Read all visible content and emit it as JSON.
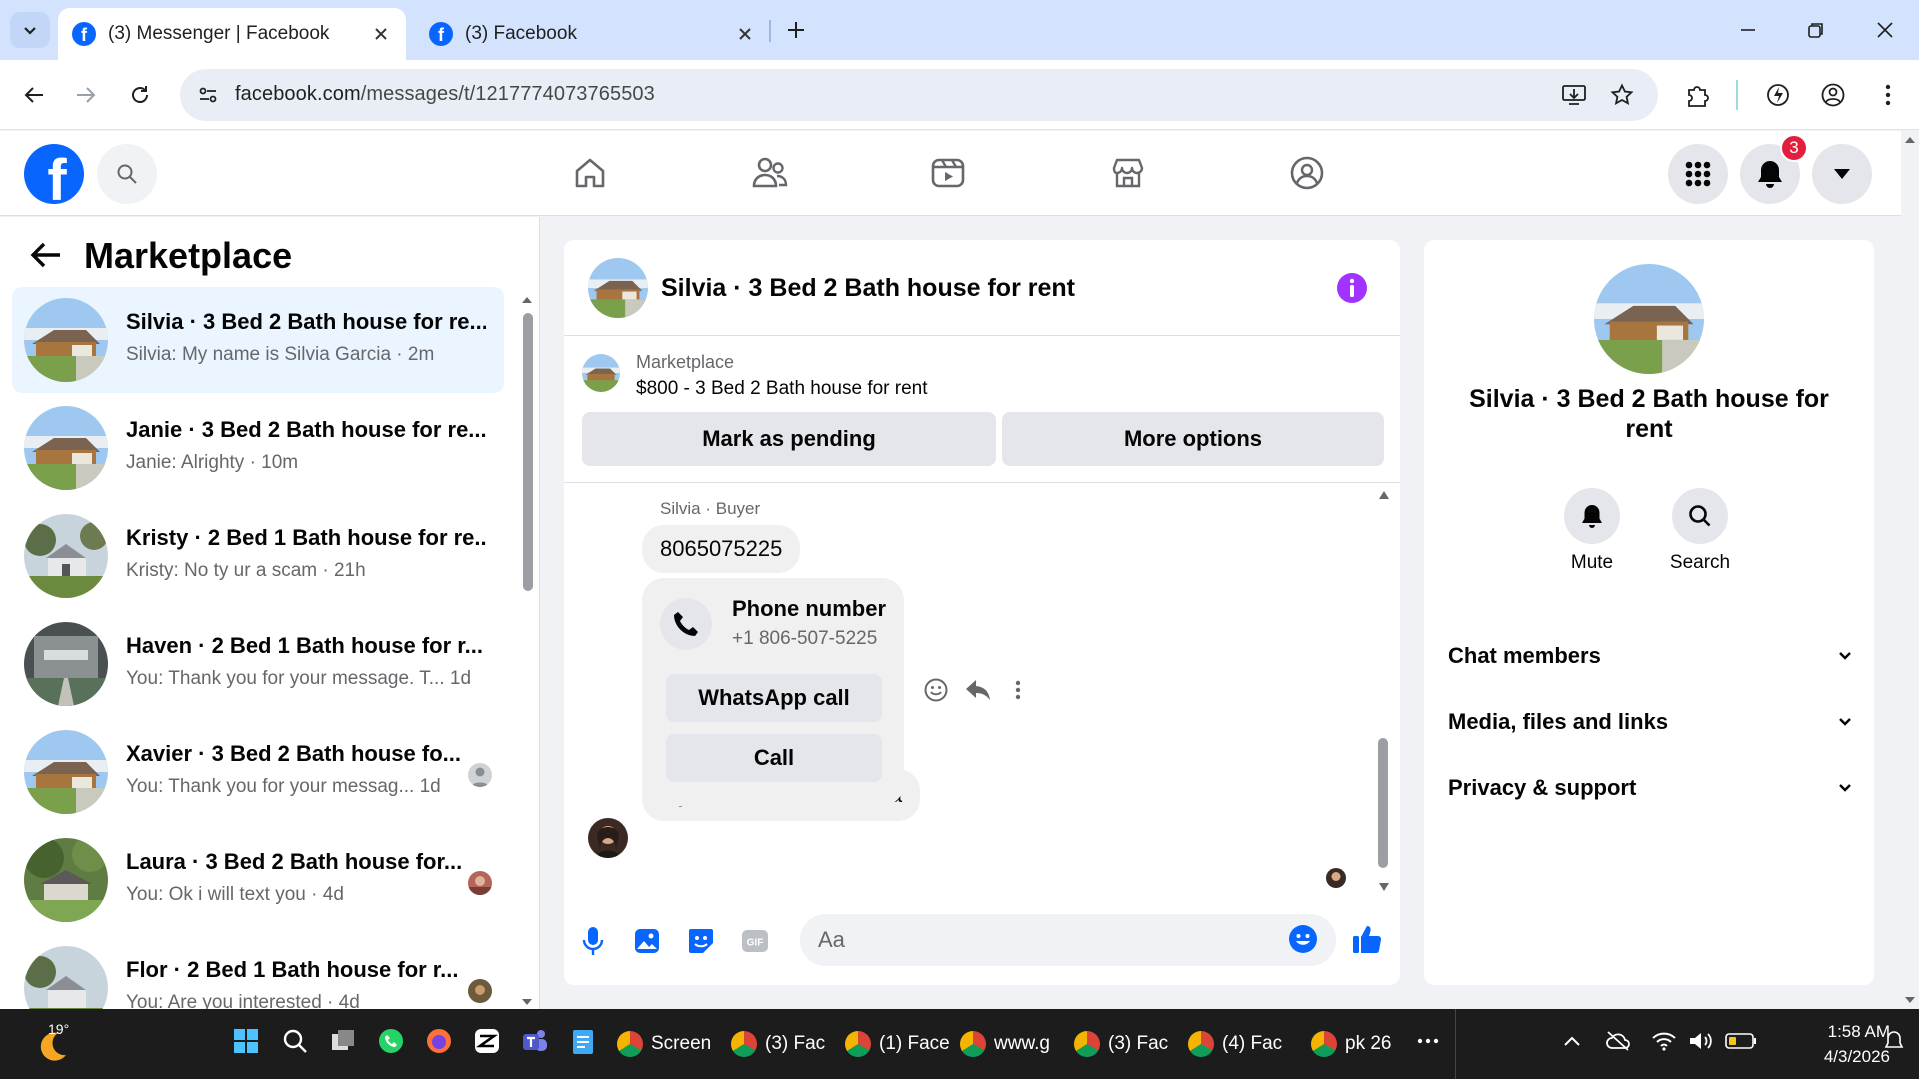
{
  "browser": {
    "tabs": [
      {
        "title": "(3) Messenger | Facebook",
        "active": true
      },
      {
        "title": "(3) Facebook",
        "active": false
      }
    ],
    "url_host": "facebook.com",
    "url_path": "/messages/t/1217774073765503"
  },
  "facebook": {
    "notification_count": "3"
  },
  "chat_list": {
    "title": "Marketplace",
    "chats": [
      {
        "title": "Silvia · 3 Bed 2 Bath house for re...",
        "subtitle": "Silvia: My name is Silvia Garcia · 2m",
        "active": true
      },
      {
        "title": "Janie · 3 Bed 2 Bath house for re...",
        "subtitle": "Janie: Alrighty · 10m"
      },
      {
        "title": "Kristy · 2 Bed 1 Bath house for re...",
        "subtitle": "Kristy: No ty ur a scam · 21h"
      },
      {
        "title": "Haven · 2 Bed 1 Bath house for r...",
        "subtitle": "You: Thank you for your message. T...  1d"
      },
      {
        "title": "Xavier · 3 Bed 2 Bath house fo...",
        "subtitle": "You: Thank you for your messag...   1d"
      },
      {
        "title": "Laura · 3 Bed 2 Bath house for...",
        "subtitle": "You: Ok i will text you · 4d"
      },
      {
        "title": "Flor · 2 Bed 1 Bath house for r...",
        "subtitle": "You: Are you interested · 4d"
      }
    ]
  },
  "conversation": {
    "title": "Silvia · 3 Bed 2 Bath house for rent",
    "listing_source": "Marketplace",
    "listing_price": "$800 - 3 Bed 2 Bath house for rent",
    "mark_pending_label": "Mark as pending",
    "more_options_label": "More options",
    "sender_line": "Silvia · Buyer",
    "messages": {
      "phone_text": "8065075225",
      "last_text": "My name is Silvia Garcia"
    },
    "phone_card": {
      "title": "Phone number",
      "number": "+1 806-507-5225",
      "whatsapp_label": "WhatsApp call",
      "call_label": "Call"
    },
    "composer_placeholder": "Aa"
  },
  "info_panel": {
    "name": "Silvia · 3 Bed 2 Bath house for rent",
    "mute_label": "Mute",
    "search_label": "Search",
    "sections": [
      "Chat members",
      "Media, files and links",
      "Privacy & support"
    ]
  },
  "taskbar": {
    "temperature": "19°",
    "apps": [
      "Screen",
      "(3) Fac",
      "(1) Face",
      "www.g",
      "(3) Fac",
      "(4) Fac",
      "pk 26"
    ],
    "time": "1:58 AM",
    "date": "4/3/2026"
  },
  "colors": {
    "facebook_blue": "#0866ff",
    "active_chat_bg": "#ebf5ff",
    "info_purple": "#a033ff",
    "badge_red": "#e41e3f",
    "tab_strip": "#d3e3fd"
  }
}
